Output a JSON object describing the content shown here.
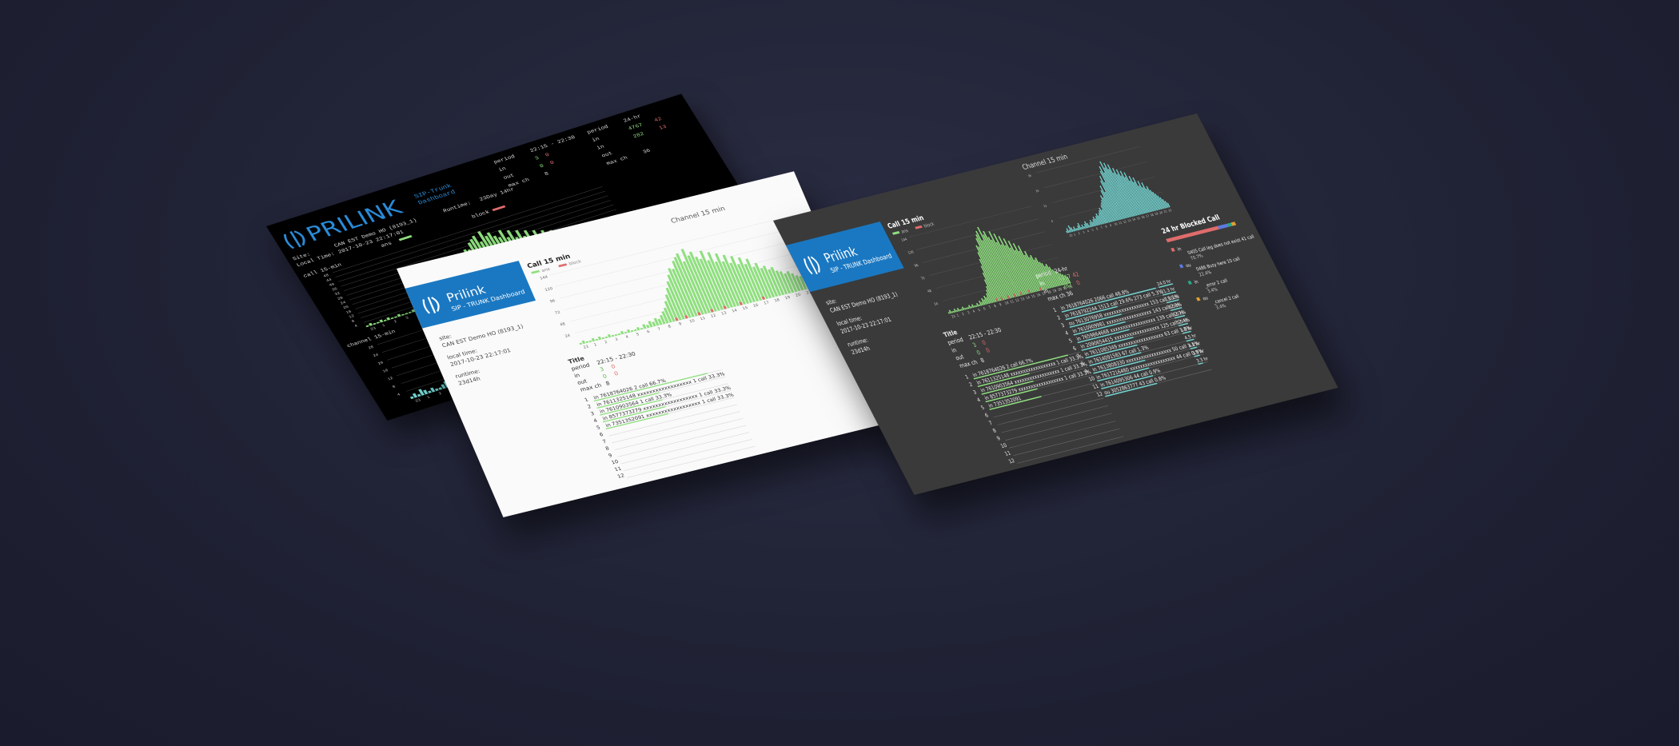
{
  "colors": {
    "green": "#8fdf7f",
    "red": "#e06c6c",
    "cyan": "#73d4d1",
    "blue": "#1a78c2",
    "brand_text": "#2a8bd8",
    "amber": "#e0a030"
  },
  "terminal": {
    "brand": "PRILINK",
    "sub1": "SIP-Trunk",
    "sub2": "Dashboard",
    "site_label": "Site:",
    "site_value": "CAN EST Demo HO (8193_1)",
    "runtime_label": "Runtime:",
    "runtime_value": "23Day 14hr",
    "local_label": "Local Time:",
    "local_value": "2017-10-23 22:17:01",
    "period_label": "period",
    "period_value": "22:15 - 22:30",
    "in_label": "in",
    "in_value": "3",
    "in_block": "0",
    "out_label": "out",
    "out_value": "0",
    "out_block": "0",
    "maxch_label": "max ch",
    "maxch_value": "8",
    "p24_label": "period",
    "p24_value": "24-hr",
    "in24_label": "in",
    "in24_value": "4767",
    "in24_block": "42",
    "in24b_label": "in",
    "in24b_value": "282",
    "in24b_block": "13",
    "out24_label": "out",
    "out24_value": "",
    "maxch24_label": "max ch",
    "maxch24_value": "36",
    "legend_ans": "ans",
    "legend_block": "block",
    "chart1_title": "call 15-min",
    "chart2_title": "channel 15-min",
    "y1": [
      "48",
      "44",
      "40",
      "36",
      "32",
      "28",
      "24",
      "20",
      "16",
      "12",
      "8",
      "4"
    ],
    "y2": [
      "28",
      "24",
      "20",
      "16",
      "12",
      "8",
      "4"
    ],
    "xt": [
      "23",
      "1",
      "2",
      "3",
      "4",
      "5",
      "6",
      "7",
      "8",
      "9",
      "10",
      "11",
      "12",
      "13",
      "14",
      "15",
      "16",
      "17",
      "18",
      "19",
      "20",
      "21",
      "22"
    ]
  },
  "light": {
    "brand": "Prilink",
    "sub": "SIP - TRUNK Dashboard",
    "site_label": "site:",
    "site_value": "CAN EST Demo HO (8193_1)",
    "local_label": "local time:",
    "local_value": "2017-10-23 22:17:01",
    "runtime_label": "runtime:",
    "runtime_value": "23d14h",
    "call_title": "Call 15 min",
    "legend_ans": "ans",
    "legend_block": "block",
    "chan_title": "Channel 15 min",
    "yt": [
      "144",
      "120",
      "96",
      "72",
      "48",
      "24"
    ],
    "xt": [
      "23",
      "1",
      "2",
      "3",
      "4",
      "5",
      "6",
      "7",
      "8",
      "9",
      "10",
      "11",
      "12",
      "13",
      "14",
      "15",
      "16",
      "17",
      "18",
      "19",
      "20",
      "21",
      "22"
    ],
    "table_title": "Title",
    "period_label": "period",
    "period_value": "22:15 - 22:30",
    "in_label": "in",
    "in_value": "3",
    "in_block": "0",
    "out_label": "out",
    "out_value": "0",
    "out_block": "0",
    "maxch_label": "max ch",
    "maxch_value": "8",
    "rows": [
      {
        "n": "1",
        "text": "in 7618764026  2 call  66.7%"
      },
      {
        "n": "2",
        "text": "in 7611325148  xxxxxxxxxxxxxxxxxx  1 call  33.3%"
      },
      {
        "n": "3",
        "text": "in 7610903564  1 call  33.3%"
      },
      {
        "n": "4",
        "text": "in 8577373279  xxxxxxxxxxxxxxxxxx  1 call  33.3%"
      },
      {
        "n": "5",
        "text": "in 7351352091  xxxxxxxxxxxxxxxxxx  1 call  33.3%"
      },
      {
        "n": "6",
        "text": ""
      },
      {
        "n": "7",
        "text": ""
      },
      {
        "n": "8",
        "text": ""
      },
      {
        "n": "9",
        "text": ""
      },
      {
        "n": "10",
        "text": ""
      },
      {
        "n": "11",
        "text": ""
      },
      {
        "n": "12",
        "text": ""
      }
    ]
  },
  "dark": {
    "brand": "Prilink",
    "sub": "SIP - TRUNK Dashboard",
    "site_label": "site:",
    "site_value": "CAN EST Demo HO (8193_1)",
    "local_label": "local time:",
    "local_value": "2017-10-23 22:17:01",
    "runtime_label": "runtime:",
    "runtime_value": "23d14h",
    "call_title": "Call 15 min",
    "legend_ans": "ans",
    "legend_block": "block",
    "chan_title": "Channel 15 min",
    "call_y": [
      "144",
      "120",
      "96",
      "72",
      "48",
      "24"
    ],
    "chan_y": [
      "36",
      "24",
      "12",
      "0"
    ],
    "xt": [
      "23",
      "1",
      "2",
      "3",
      "4",
      "5",
      "6",
      "7",
      "8",
      "9",
      "10",
      "11",
      "12",
      "13",
      "14",
      "15",
      "16",
      "17",
      "18",
      "19",
      "20",
      "21",
      "22"
    ],
    "table_title": "Title",
    "period_label": "period",
    "period_value": "22:15 - 22:30",
    "in_label": "in",
    "in_value": "3",
    "in_block": "0",
    "out_label": "out",
    "out_value": "0",
    "out_block": "0",
    "maxch_label": "max ch",
    "maxch_value": "8",
    "rows": [
      {
        "n": "1",
        "text": "in 7618764026  2 call  66.7%"
      },
      {
        "n": "2",
        "text": "in 7611325148  xxxxxxxxxxxxxxxxxx  1 call  33.3%"
      },
      {
        "n": "3",
        "text": "in 7610903564  xxxxxxxxxxxxxxxxxx  1 call  33.3%"
      },
      {
        "n": "4",
        "text": "in 8577373279  xxxxxxxxxxxxxxxxxx  1 call  33.3%"
      },
      {
        "n": "5",
        "text": "in 7351352091"
      },
      {
        "n": "6",
        "text": ""
      },
      {
        "n": "7",
        "text": ""
      },
      {
        "n": "8",
        "text": ""
      },
      {
        "n": "9",
        "text": ""
      },
      {
        "n": "10",
        "text": ""
      },
      {
        "n": "11",
        "text": ""
      },
      {
        "n": "12",
        "text": ""
      }
    ],
    "h24_period_label": "period",
    "h24_period_value": "24-hr",
    "h24_in_label": "in",
    "h24_in_value": "4767",
    "h24_in_block": "42",
    "h24_out_label": "in",
    "h24_out_value": "282",
    "h24_out_block": "0",
    "h24_maxch_label": "max ch",
    "h24_maxch_value": "36",
    "rows24": [
      {
        "n": "1",
        "text": "in 7618764026  2066 call  48.8%"
      },
      {
        "n": "2",
        "text": "in 7618792244  1513 call  29.6%  273 call  5.3%"
      },
      {
        "n": "3",
        "text": "ou 7613076958  xxxxxxxxxxxxxxxxxx  153 call  3.1%"
      },
      {
        "n": "4",
        "text": "in 7610909981  xxxxxxxxxxxxxxxxxx  143 call  2.8%"
      },
      {
        "n": "5",
        "text": "in 7659864668  xxxxxxxxxxxxxxxxxx  139 call  2.7%"
      },
      {
        "n": "6",
        "text": "in 2090654415  xxxxxxxxxxxxxxxxxx  125 call  2.4%"
      },
      {
        "n": "7",
        "text": "in 7611085349  xxxxxxxxxxxxxxxxxx  63 call  1.8%"
      },
      {
        "n": "8",
        "text": "in 7614091583  67 call  1.3%"
      },
      {
        "n": "9",
        "text": "in 7613808330  xxxxxxxxxxxxxxxxxx  50 call  1.1%"
      },
      {
        "n": "10",
        "text": "in 7617216480  xxxxxxxxxxxxxxxxxx  44 call  0.9%"
      },
      {
        "n": "11",
        "text": "in 7614095306  44 call  0.9%"
      },
      {
        "n": "12",
        "text": "ou 3052863777  43 call  0.8%"
      }
    ],
    "hr_col": [
      "24.0 hr",
      "21.3 hr",
      "13.0 hr",
      "8.5 hr",
      "8.0 hr",
      "5.5 hr",
      "5.0 hr",
      "4.5 hr",
      "4.0 hr",
      "3.5 hr",
      "3.3 hr"
    ],
    "blocked_title": "24 hr Blocked Call",
    "blocked": [
      {
        "dir": "in",
        "code": "0405",
        "desc": "Call leg does not exist",
        "count": "41 call",
        "pct": "70.7%"
      },
      {
        "dir": "ou",
        "code": "0486",
        "desc": "Busy here",
        "count": "10 call",
        "pct": "22.4%"
      },
      {
        "dir": "in",
        "code": "",
        "desc": "_error",
        "count": "2 call",
        "pct": "3.4%"
      },
      {
        "dir": "ou",
        "code": "",
        "desc": "_cancel",
        "count": "2 call",
        "pct": "3.4%"
      }
    ]
  },
  "chart_data": [
    {
      "type": "bar",
      "title": "call 15-min",
      "series": [
        {
          "name": "ans",
          "values": [
            1,
            2,
            1,
            1,
            2,
            1,
            2,
            1,
            1,
            2,
            1,
            1,
            1,
            2,
            1,
            2,
            1,
            1,
            2,
            1,
            3,
            2,
            4,
            3,
            5,
            4,
            6,
            8,
            10,
            14,
            18,
            22,
            26,
            30,
            34,
            33,
            38,
            40,
            42,
            36,
            44,
            39,
            41,
            37,
            35,
            40,
            33,
            38,
            31,
            36,
            30,
            34,
            28,
            32,
            26,
            30,
            25,
            28,
            22,
            24,
            20,
            21,
            18,
            19,
            16,
            15,
            13,
            14,
            12,
            10,
            9,
            8,
            7,
            6,
            5,
            4
          ]
        },
        {
          "name": "block",
          "values": [
            0,
            0,
            0,
            0,
            0,
            0,
            0,
            0,
            0,
            0,
            0,
            0,
            0,
            0,
            0,
            0,
            0,
            0,
            0,
            0,
            0,
            0,
            0,
            0,
            0,
            0,
            0,
            0,
            0,
            0,
            1,
            0,
            0,
            1,
            0,
            0,
            0,
            1,
            0,
            0,
            0,
            1,
            0,
            0,
            0,
            1,
            0,
            0,
            0,
            0,
            1,
            0,
            0,
            0,
            0,
            0,
            0,
            1,
            0,
            0,
            0,
            0,
            0,
            0,
            0,
            0,
            0,
            0,
            0,
            0,
            0,
            0,
            0,
            0,
            0,
            0
          ]
        }
      ],
      "ylim": [
        0,
        48
      ]
    },
    {
      "type": "bar",
      "title": "channel 15-min",
      "series": [
        {
          "name": "",
          "values": [
            1,
            2,
            1,
            3,
            2,
            1,
            2,
            1,
            1,
            2,
            3,
            1,
            2,
            1,
            2,
            3,
            2,
            1,
            2,
            3,
            2,
            3,
            4,
            3,
            4,
            5,
            4,
            5,
            6,
            7,
            6,
            8,
            9,
            10,
            12,
            11,
            14,
            16,
            13,
            18,
            20,
            17,
            22,
            24,
            21,
            26,
            23,
            25,
            22,
            24,
            20,
            22,
            19,
            21,
            18,
            20,
            17,
            19,
            15,
            17,
            14,
            16,
            12,
            14,
            11,
            13,
            10,
            11,
            9,
            8,
            7,
            6,
            5,
            4,
            3,
            2
          ]
        }
      ],
      "ylim": [
        0,
        28
      ]
    }
  ]
}
